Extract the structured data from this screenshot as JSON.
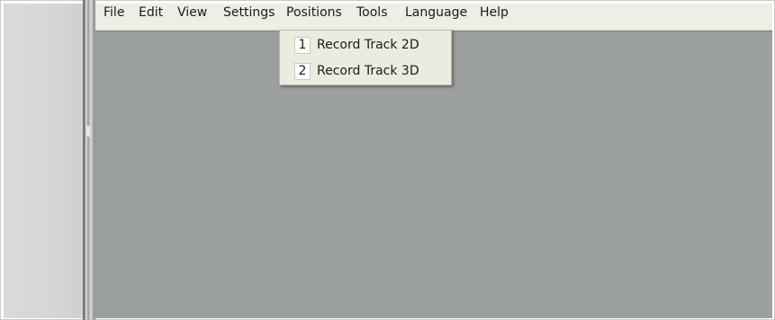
{
  "menubar": {
    "items": [
      {
        "label": "File"
      },
      {
        "label": "Edit"
      },
      {
        "label": "View"
      },
      {
        "label": "Settings"
      },
      {
        "label": "Positions"
      },
      {
        "label": "Tools"
      },
      {
        "label": "Language"
      },
      {
        "label": "Help"
      }
    ]
  },
  "dropdown": {
    "parent": "Positions",
    "items": [
      {
        "key": "1",
        "label": "Record Track 2D"
      },
      {
        "key": "2",
        "label": "Record Track 3D"
      }
    ]
  },
  "colors": {
    "menubar_bg": "#edeee4",
    "workspace_bg": "#9c9fa0",
    "dropdown_bg": "#ebebdf",
    "left_panel_bg": "#d6d8d8"
  }
}
